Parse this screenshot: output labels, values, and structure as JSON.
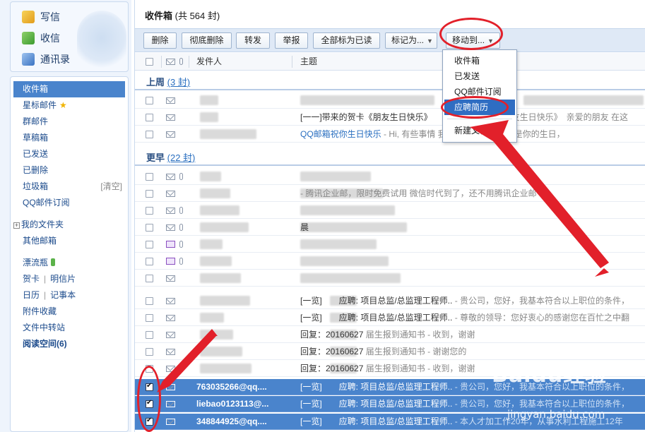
{
  "sidebar": {
    "compose_label": "写信",
    "receive_label": "收信",
    "contacts_label": "通讯录",
    "folders": [
      {
        "label": "收件箱"
      },
      {
        "label": "星标邮件"
      },
      {
        "label": "群邮件"
      },
      {
        "label": "草稿箱"
      },
      {
        "label": "已发送"
      },
      {
        "label": "已删除"
      },
      {
        "label": "垃圾箱",
        "action": "[清空]"
      },
      {
        "label": "QQ邮件订阅"
      }
    ],
    "my_folders_label": "我的文件夹",
    "other_mailbox_label": "其他邮箱",
    "bottle_label": "漂流瓶",
    "card_label": "贺卡",
    "postcard_label": "明信片",
    "calendar_label": "日历",
    "notes_label": "记事本",
    "attachments_label": "附件收藏",
    "file_transfer_label": "文件中转站",
    "reading_label": "阅读空间(6)"
  },
  "main": {
    "title": "收件箱",
    "count_text": "(共 564 封)"
  },
  "toolbar": {
    "delete": "删除",
    "perm_delete": "彻底删除",
    "forward": "转发",
    "report": "举报",
    "mark_all_read": "全部标为已读",
    "mark_as": "标记为...",
    "move_to": "移动到..."
  },
  "columns": {
    "sender": "发件人",
    "subject": "主题"
  },
  "groups": {
    "last_week": {
      "label": "上周",
      "count": "(3 封)"
    },
    "earlier": {
      "label": "更早",
      "count": "(22 封)"
    }
  },
  "last_week_rows": [
    {
      "sender": "",
      "subject": "",
      "preview": ""
    },
    {
      "sender": "",
      "subject": "[一一]带来的贺卡《朋友生日快乐》",
      "preview": "朋友生日快乐》　亲爱的朋友 在这"
    },
    {
      "sender": "",
      "subject": "QQ邮箱祝你生日快乐",
      "preview": "- Hi, 有些事情    我们依然记得。今天是你的生日，"
    }
  ],
  "earlier_rows": [
    {
      "sender": "",
      "subject": "",
      "preview": ""
    },
    {
      "sender": "",
      "subject": "",
      "preview": "- 腾讯企业邮，限时免费试用 微信时代到了，还不用腾讯企业邮"
    },
    {
      "sender": "",
      "subject": "",
      "preview": ""
    },
    {
      "sender": "",
      "subject": "晨",
      "preview": ""
    },
    {
      "sender": "",
      "subject": "",
      "preview": ""
    },
    {
      "sender": "",
      "subject": "",
      "preview": ""
    },
    {
      "sender": "",
      "subject": "",
      "preview": ""
    },
    {
      "sender": "",
      "subject": "[一览]　　应聘: 项目总监/总监理工程师..",
      "preview": "- 贵公司，您好，我基本符合以上职位的条件，"
    },
    {
      "sender": "",
      "subject": "[一览]　　应聘: 项目总监/总监理工程师..",
      "preview": "- 尊敬的领导：您好衷心的感谢您在百忙之中翻"
    },
    {
      "sender": "",
      "subject": "回复：20160627",
      "preview": "届生报到通知书 - 收到，谢谢"
    },
    {
      "sender": "",
      "subject": "回复：20160627",
      "preview": "届生报到通知书 - 谢谢您的"
    },
    {
      "sender": "",
      "subject": "回复：20160627",
      "preview": "届生报到通知书 - 收到，谢谢"
    }
  ],
  "selected_rows": [
    {
      "sender": "763035266@qq....",
      "subject": "[一览]　　应聘: 项目总监/总监理工程师..",
      "preview": "- 贵公司，您好，我基本符合以上职位的条件，"
    },
    {
      "sender": "liebao0123113@...",
      "subject": "[一览]　　应聘: 项目总监/总监理工程师..",
      "preview": "- 贵公司，您好，我基本符合以上职位的条件，"
    },
    {
      "sender": "348844925@qq....",
      "subject": "[一览]　　应聘: 项目总监/总监理工程师..",
      "preview": "- 本人才加工作20年，从事水利工程施工12年"
    }
  ],
  "dropdown": {
    "items": [
      "收件箱",
      "已发送",
      "QQ邮件订阅",
      "应聘简历"
    ],
    "new_folder": "新建文件夹..."
  },
  "watermark": {
    "brand": "Baidu经验",
    "url": "jingyan.baidu.com"
  },
  "colors": {
    "accent": "#4a84cc",
    "highlight": "#2f6dc2",
    "annotation": "#e2202a"
  }
}
